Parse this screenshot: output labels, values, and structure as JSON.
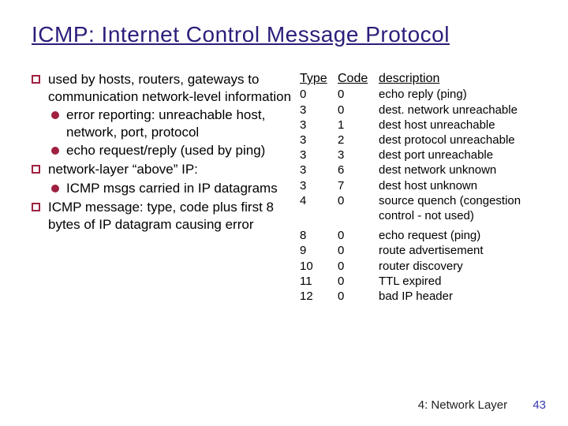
{
  "title": "ICMP: Internet Control Message Protocol",
  "bullets": {
    "b0": {
      "text": "used by hosts, routers, gateways to communication network-level information",
      "subs": {
        "s0": "error reporting: unreachable host, network, port, protocol",
        "s1": "echo request/reply (used by ping)"
      }
    },
    "b1": {
      "text": "network-layer “above” IP:",
      "subs": {
        "s0": "ICMP msgs carried in IP datagrams"
      }
    },
    "b2": {
      "text": "ICMP message: type, code plus first 8 bytes of IP datagram causing error"
    }
  },
  "table": {
    "header": {
      "c1": "Type",
      "c2": "Code",
      "c3": "description"
    },
    "rows": [
      {
        "c1": "0",
        "c2": "0",
        "c3": "echo reply (ping)"
      },
      {
        "c1": "3",
        "c2": "0",
        "c3": "dest. network unreachable"
      },
      {
        "c1": "3",
        "c2": "1",
        "c3": "dest host unreachable"
      },
      {
        "c1": "3",
        "c2": "2",
        "c3": "dest protocol unreachable"
      },
      {
        "c1": "3",
        "c2": "3",
        "c3": "dest port unreachable"
      },
      {
        "c1": "3",
        "c2": "6",
        "c3": "dest network unknown"
      },
      {
        "c1": "3",
        "c2": "7",
        "c3": "dest host unknown"
      },
      {
        "c1": "4",
        "c2": "0",
        "c3": "source quench (congestion control - not used)"
      },
      {
        "c1": "8",
        "c2": "0",
        "c3": "echo request (ping)"
      },
      {
        "c1": "9",
        "c2": "0",
        "c3": "route advertisement"
      },
      {
        "c1": "10",
        "c2": "0",
        "c3": "router discovery"
      },
      {
        "c1": "11",
        "c2": "0",
        "c3": "TTL expired"
      },
      {
        "c1": "12",
        "c2": "0",
        "c3": "bad IP header"
      }
    ]
  },
  "footer": {
    "section": "4: Network Layer",
    "page": "43"
  }
}
